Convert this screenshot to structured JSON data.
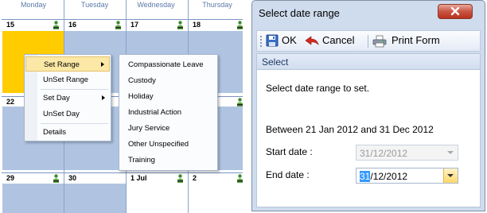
{
  "calendar": {
    "weekdays": [
      "Monday",
      "Tuesday",
      "Wednesday",
      "Thursday"
    ],
    "week1_dates": [
      "15",
      "16",
      "17",
      "18"
    ],
    "week2_dates": [
      "22"
    ],
    "week3_dates": [
      "29",
      "30",
      "1 Jul",
      "2"
    ]
  },
  "context_menu": {
    "items": [
      {
        "label": "Set Range",
        "has_submenu": true
      },
      {
        "label": "UnSet Range",
        "has_submenu": false
      },
      {
        "label": "Set Day",
        "has_submenu": true
      },
      {
        "label": "UnSet Day",
        "has_submenu": false
      },
      {
        "label": "Details",
        "has_submenu": false
      }
    ]
  },
  "submenu": {
    "items": [
      "Compassionate Leave",
      "Custody",
      "Holiday",
      "Industrial Action",
      "Jury Service",
      "Other Unspecified",
      "Training"
    ]
  },
  "dialog": {
    "title": "Select date range",
    "close_icon": "close-x-icon",
    "toolbar": {
      "ok_label": "OK",
      "cancel_label": "Cancel",
      "print_label": "Print Form",
      "ok_icon": "save-disk-icon",
      "cancel_icon": "red-back-arrow-icon",
      "print_icon": "print-form-icon"
    },
    "group_title": "Select",
    "instruction": "Select date range to set.",
    "range_text": "Between 21 Jan 2012 and 31 Dec 2012",
    "start_label": "Start date :",
    "start_value": "31/12/2012",
    "end_label": "End date :",
    "end_value_selected": "31",
    "end_value_rest": "/12/2012"
  },
  "colors": {
    "calendar_cell": "#b0c4e2",
    "selected_day": "#ffcc00",
    "menu_highlight": "#fce8a6",
    "dialog_frame": "#cfdced",
    "close_button": "#c85442"
  }
}
